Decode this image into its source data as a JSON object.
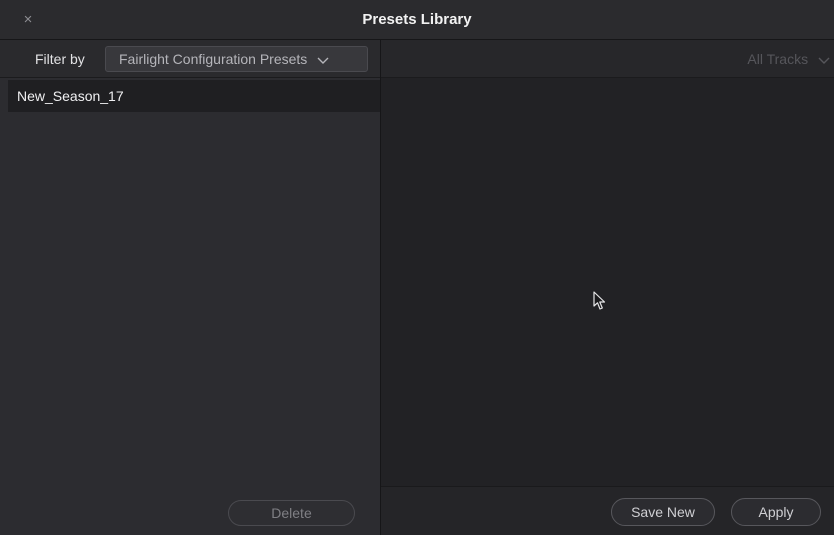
{
  "window": {
    "title": "Presets Library",
    "close_glyph": "×"
  },
  "filter": {
    "label": "Filter by",
    "selected": "Fairlight Configuration Presets"
  },
  "presets": {
    "items": [
      {
        "label": "New_Season_17",
        "selected": true
      }
    ]
  },
  "left_footer": {
    "delete_label": "Delete"
  },
  "tracks": {
    "selected": "All Tracks"
  },
  "right_footer": {
    "save_new_label": "Save New",
    "apply_label": "Apply"
  },
  "colors": {
    "background": "#1e1e20",
    "panel": "#2c2c30",
    "selection": "#1f1f22",
    "text": "#f0f0f2",
    "muted_text": "#7f7f84"
  },
  "icons": {
    "close": "close-icon",
    "dropdown": "chevron-down-icon",
    "pointer": "mouse-pointer-icon"
  }
}
